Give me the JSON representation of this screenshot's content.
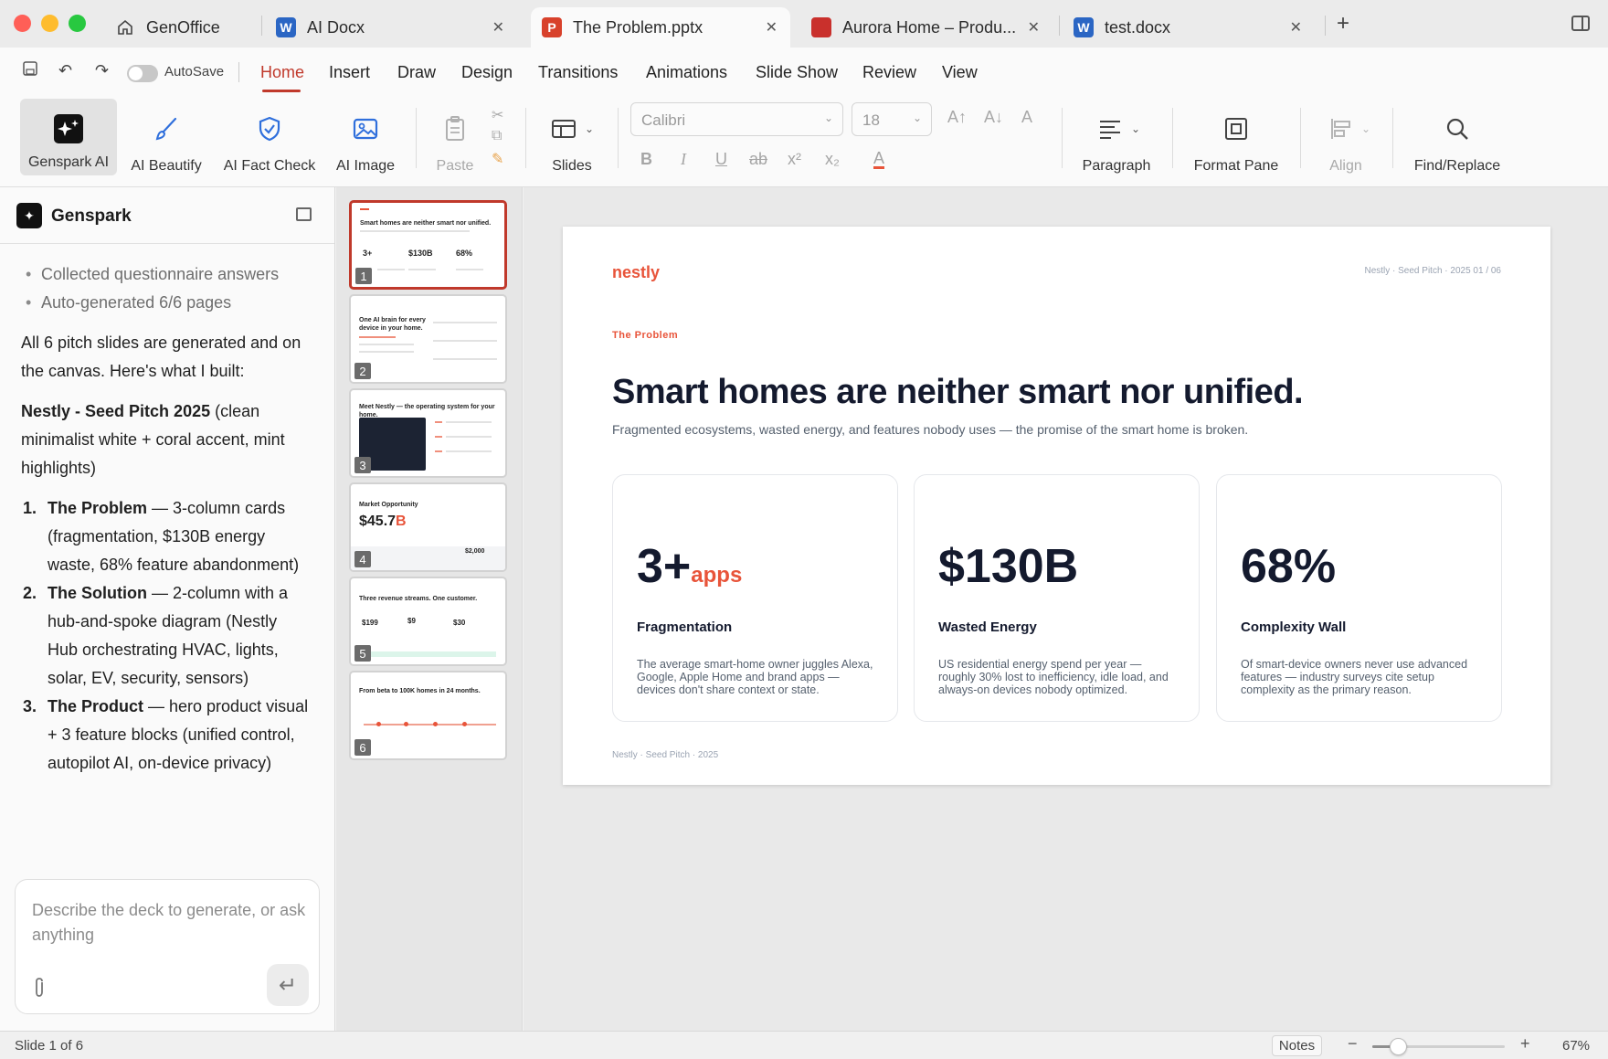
{
  "tabs": [
    {
      "title": "GenOffice",
      "icon": "home-icon",
      "closable": false
    },
    {
      "title": "AI Docx",
      "icon": "word-icon",
      "closable": true
    },
    {
      "title": "The Problem.pptx",
      "icon": "powerpoint-icon",
      "closable": true,
      "active": true
    },
    {
      "title": "Aurora Home – Produ...",
      "icon": "pdf-icon",
      "closable": true
    },
    {
      "title": "test.docx",
      "icon": "word-icon",
      "closable": true
    }
  ],
  "quick_access": {
    "autosave_label": "AutoSave",
    "autosave_on": false
  },
  "menu": {
    "items": [
      "Home",
      "Insert",
      "Draw",
      "Design",
      "Transitions",
      "Animations",
      "Slide Show",
      "Review",
      "View"
    ],
    "active": "Home"
  },
  "ribbon": {
    "genspark_ai": "Genspark AI",
    "ai_beautify": "AI Beautify",
    "ai_fact_check": "AI Fact Check",
    "ai_image": "AI Image",
    "paste": "Paste",
    "slides": "Slides",
    "font_name": "Calibri",
    "font_size": "18",
    "paragraph": "Paragraph",
    "format_pane": "Format Pane",
    "align": "Align",
    "find_replace": "Find/Replace",
    "format_glyphs": {
      "bold": "B",
      "italic": "I",
      "underline": "U",
      "strike": "ab",
      "superscript": "x²",
      "subscript": "x₂",
      "font_color": "A"
    }
  },
  "assistant": {
    "title": "Genspark",
    "status_items": [
      "Collected questionnaire answers",
      "Auto-generated 6/6 pages"
    ],
    "intro": "All 6 pitch slides are generated and on the canvas. Here's what I built:",
    "deck_name": "Nestly - Seed Pitch 2025",
    "deck_desc": " (clean minimalist white + coral accent, mint highlights)",
    "list": [
      {
        "num": "1.",
        "title": "The Problem",
        "desc": " — 3-column cards (fragmentation, $130B energy waste, 68% feature abandonment)"
      },
      {
        "num": "2.",
        "title": "The Solution",
        "desc": " — 2-column with a hub-and-spoke diagram (Nestly Hub orchestrating HVAC, lights, solar, EV, security, sensors)"
      },
      {
        "num": "3.",
        "title": "The Product",
        "desc": " — hero product visual + 3 feature blocks (unified control, autopilot AI, on-device privacy)"
      }
    ],
    "input_placeholder": "Describe the deck to generate, or ask anything"
  },
  "thumbnails": [
    {
      "num": "1",
      "title": "Smart homes are neither smart nor unified.",
      "stats": [
        "3+",
        "$130B",
        "68%"
      ]
    },
    {
      "num": "2",
      "title": "One AI brain for every device in your home."
    },
    {
      "num": "3",
      "title": "Meet Nestly — the operating system for your home."
    },
    {
      "num": "4",
      "title": "Market Opportunity",
      "big": "$45.7",
      "big_suffix": "B",
      "stats": [
        "$2,000"
      ]
    },
    {
      "num": "5",
      "title": "Three revenue streams. One customer.",
      "stats": [
        "$199",
        "$9",
        "$30"
      ]
    },
    {
      "num": "6",
      "title": "From beta to 100K homes in 24 months."
    }
  ],
  "slide": {
    "brand": "nestly",
    "meta": "Nestly · Seed Pitch · 2025 01 / 06",
    "eyebrow": "The Problem",
    "headline": "Smart homes are neither smart nor unified.",
    "subtitle": "Fragmented ecosystems, wasted energy, and features nobody uses — the promise of the smart home is broken.",
    "cards": [
      {
        "stat": "3+",
        "suffix": "apps",
        "title": "Fragmentation",
        "desc": "The average smart-home owner juggles Alexa, Google, Apple Home and brand apps — devices don't share context or state."
      },
      {
        "stat": "$130B",
        "suffix": "",
        "title": "Wasted Energy",
        "desc": "US residential energy spend per year — roughly 30% lost to inefficiency, idle load, and always-on devices nobody optimized."
      },
      {
        "stat": "68%",
        "suffix": "",
        "title": "Complexity Wall",
        "desc": "Of smart-device owners never use advanced features — industry surveys cite setup complexity as the primary reason."
      }
    ],
    "footer": "Nestly · Seed Pitch · 2025"
  },
  "status": {
    "slide_count": "Slide 1 of 6",
    "notes": "Notes",
    "zoom": "67%",
    "zoom_level": 0.2
  },
  "colors": {
    "accent": "#e8543a",
    "menu_active": "#c0392b",
    "navy": "#141a2e"
  }
}
